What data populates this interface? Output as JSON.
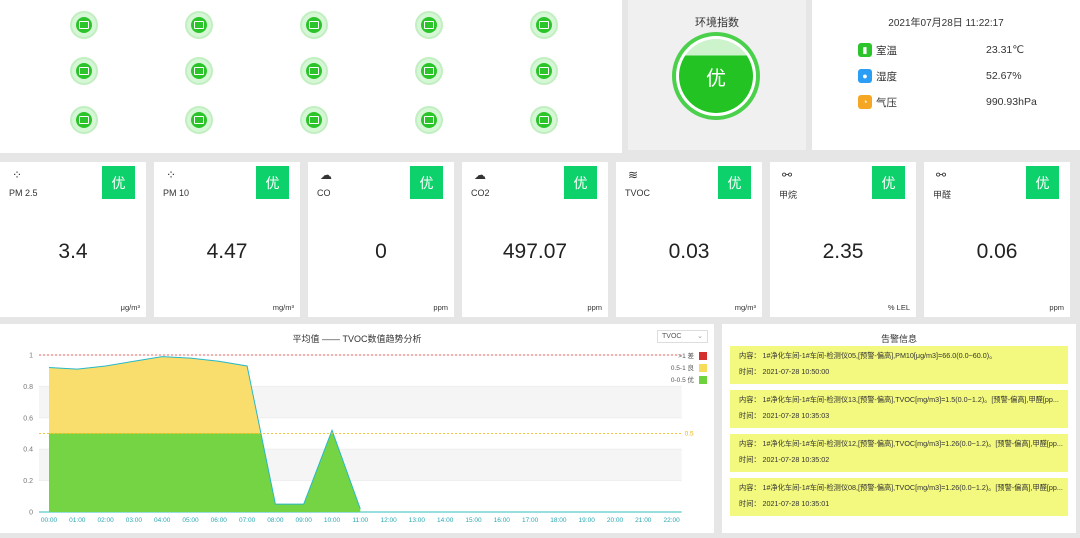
{
  "env_index": {
    "title": "环境指数",
    "level": "优"
  },
  "env_readings": {
    "datetime": "2021年07月28日 11:22:17",
    "items": [
      {
        "label": "室温",
        "value": "23.31℃",
        "icon": "thermometer-icon",
        "color": "#2bc52b"
      },
      {
        "label": "湿度",
        "value": "52.67%",
        "icon": "humidity-icon",
        "color": "#2a9df4"
      },
      {
        "label": "气压",
        "value": "990.93hPa",
        "icon": "pressure-icon",
        "color": "#f5a623"
      }
    ]
  },
  "metrics": [
    {
      "name": "PM 2.5",
      "level": "优",
      "value": "3.4",
      "unit": "μg/m³",
      "icon": "particles-icon"
    },
    {
      "name": "PM 10",
      "level": "优",
      "value": "4.47",
      "unit": "mg/m³",
      "icon": "particles-icon"
    },
    {
      "name": "CO",
      "level": "优",
      "value": "0",
      "unit": "ppm",
      "icon": "co-cloud-icon"
    },
    {
      "name": "CO2",
      "level": "优",
      "value": "497.07",
      "unit": "ppm",
      "icon": "co2-cloud-icon"
    },
    {
      "name": "TVOC",
      "level": "优",
      "value": "0.03",
      "unit": "mg/m³",
      "icon": "vapor-icon"
    },
    {
      "name": "甲烷",
      "level": "优",
      "value": "2.35",
      "unit": "% LEL",
      "icon": "molecule-icon"
    },
    {
      "name": "甲醛",
      "level": "优",
      "value": "0.06",
      "unit": "ppm",
      "icon": "molecule-icon"
    }
  ],
  "chart": {
    "selector": "TVOC"
  },
  "chart_data": {
    "type": "area",
    "title": "平均值 —— TVOC数值趋势分析",
    "x": [
      "00:00",
      "01:00",
      "02:00",
      "03:00",
      "04:00",
      "05:00",
      "06:00",
      "07:00",
      "08:00",
      "09:00",
      "10:00",
      "11:00",
      "12:00",
      "13:00",
      "14:00",
      "15:00",
      "16:00",
      "17:00",
      "18:00",
      "19:00",
      "20:00",
      "21:00",
      "22:00"
    ],
    "y_labels": [
      "0",
      "0.2",
      "0.4",
      "0.6",
      "0.8",
      "1"
    ],
    "ylim": [
      0,
      1
    ],
    "series": [
      {
        "values": [
          0.92,
          0.91,
          0.93,
          0.96,
          0.99,
          0.98,
          0.96,
          0.93,
          0.05,
          0.05,
          0.52,
          0.02
        ]
      }
    ],
    "markers": [
      {
        "value": 1,
        "color": "#e53935"
      },
      {
        "value": 0.5,
        "color": "#f0b400",
        "label": "0.5"
      }
    ],
    "legend": [
      {
        "name": ">1 差",
        "color": "#d32f2f"
      },
      {
        "name": "0.5-1 良",
        "color": "#f7dc5a"
      },
      {
        "name": "0-0.5 优",
        "color": "#6fd13b"
      }
    ],
    "legend_position": "top-right"
  },
  "alarms": {
    "title": "告警信息",
    "items": [
      {
        "content": "内容：  1#净化车间-1#车间-检测仪05,[预警-偏高],PM10[μg/m3]=66.0(0.0~60.0)。",
        "time": "时间：  2021-07-28 10:50:00"
      },
      {
        "content": "内容：  1#净化车间-1#车间-检测仪13,[预警-偏高],TVOC[mg/m3]=1.5(0.0~1.2)。[预警-偏高],甲醛[pp...",
        "time": "时间：  2021-07-28 10:35:03"
      },
      {
        "content": "内容：  1#净化车间-1#车间-检测仪12,[预警-偏高],TVOC[mg/m3]=1.26(0.0~1.2)。[预警-偏高],甲醛[pp...",
        "time": "时间：  2021-07-28 10:35:02"
      },
      {
        "content": "内容：  1#净化车间-1#车间-检测仪08,[预警-偏高],TVOC[mg/m3]=1.26(0.0~1.2)。[预警-偏高],甲醛[pp...",
        "time": "时间：  2021-07-28 10:35:01"
      }
    ]
  }
}
